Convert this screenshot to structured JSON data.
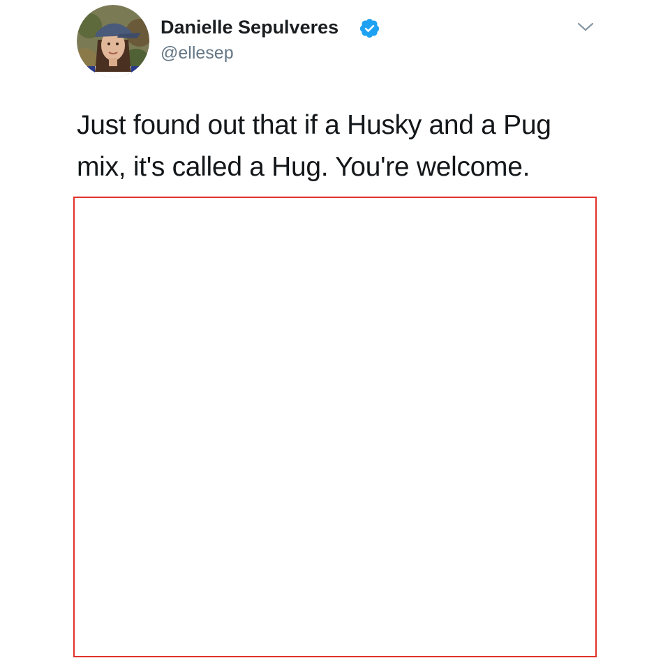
{
  "tweet": {
    "author": {
      "display_name": "Danielle Sepulveres",
      "handle": "@ellesep",
      "verified": true
    },
    "text": "Just found out that if a Husky and a Pug mix, it's called a Hug. You're welcome.",
    "icons": {
      "verified": "verified-badge-icon",
      "menu": "chevron-down-icon"
    }
  },
  "colors": {
    "verified_badge": "#1da1f2",
    "handle": "#657786",
    "media_border": "#e0322b"
  }
}
